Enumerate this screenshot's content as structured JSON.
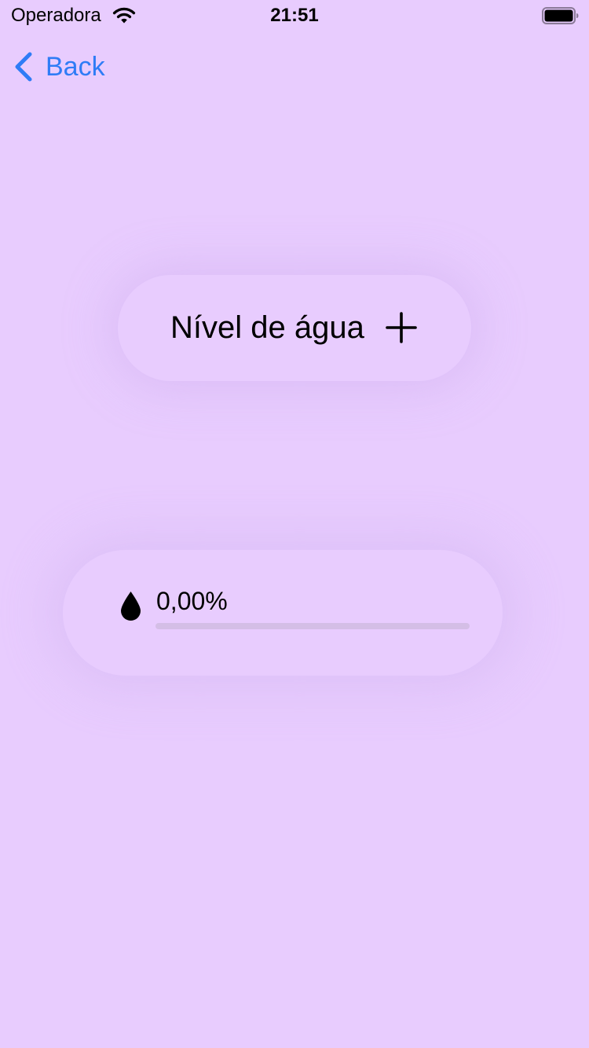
{
  "status_bar": {
    "carrier": "Operadora",
    "time": "21:51",
    "icons": [
      "wifi-icon",
      "battery-icon"
    ]
  },
  "navigation": {
    "back_label": "Back",
    "back_icon": "chevron-left-icon"
  },
  "water": {
    "title": "Nível de água",
    "add_icon": "plus-icon"
  },
  "progress": {
    "icon": "water-drop-icon",
    "label": "0,00%",
    "value": 0
  },
  "colors": {
    "background": "#E8CCFE",
    "accent": "#2F7CF6",
    "track": "#D4BEE6",
    "text": "#000000"
  }
}
